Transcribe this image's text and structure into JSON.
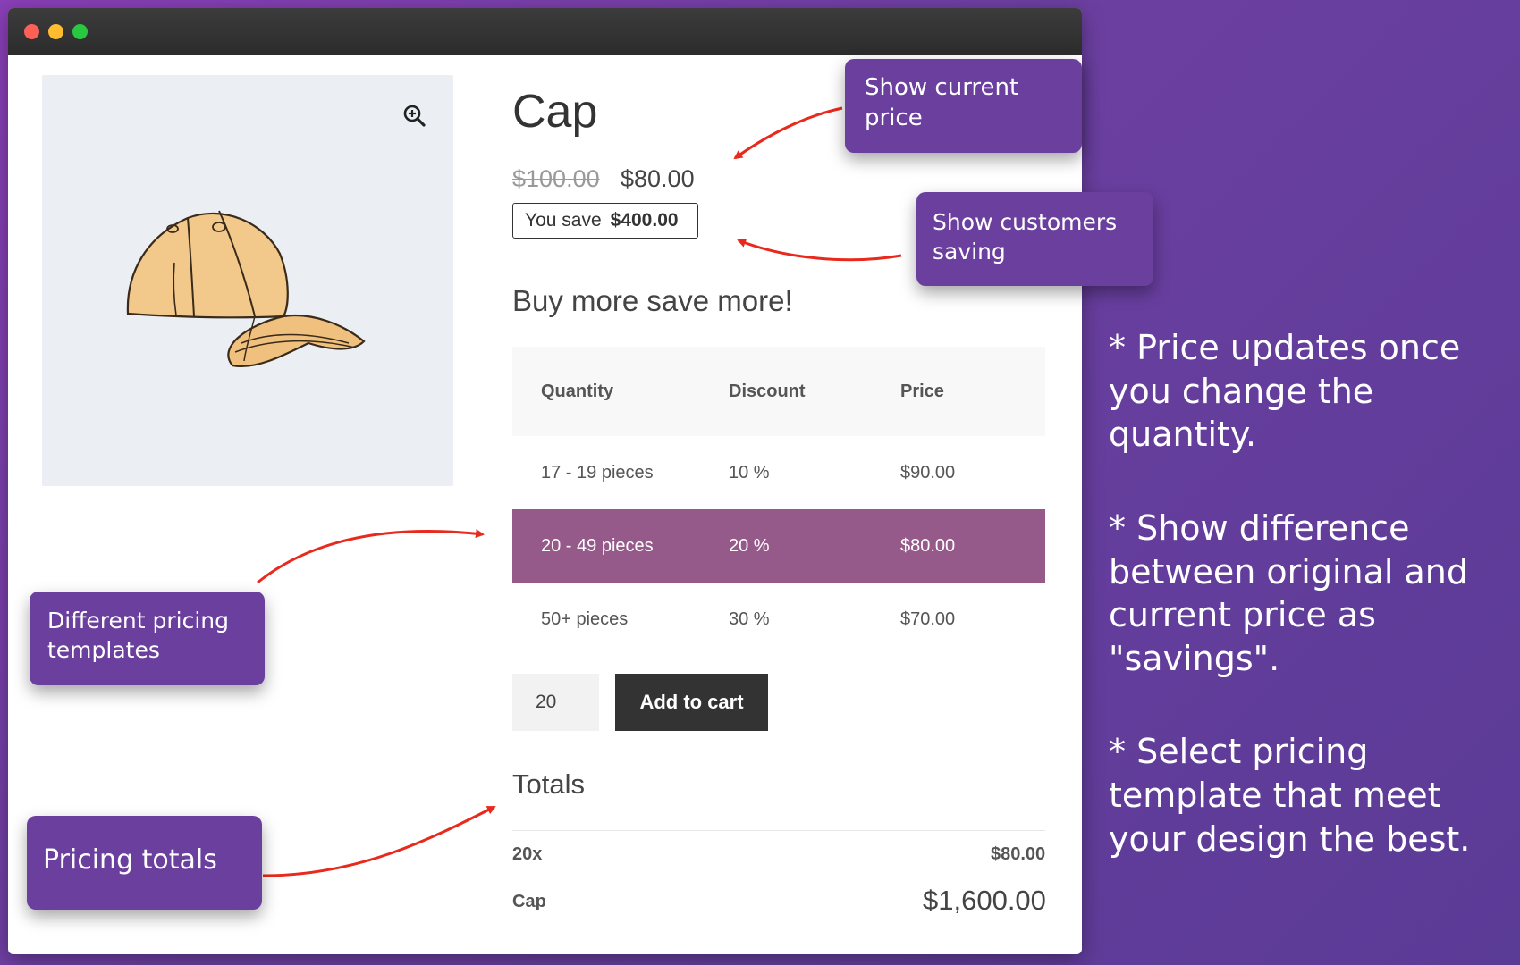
{
  "product": {
    "title": "Cap",
    "price_old": "$100.00",
    "price_new": "$80.00",
    "save_label": "You save",
    "save_amount": "$400.00"
  },
  "pricing": {
    "heading": "Buy more save more!",
    "columns": [
      "Quantity",
      "Discount",
      "Price"
    ],
    "rows": [
      {
        "quantity": "17 - 19 pieces",
        "discount": "10 %",
        "price": "$90.00"
      },
      {
        "quantity": "20 - 49 pieces",
        "discount": "20 %",
        "price": "$80.00"
      },
      {
        "quantity": "50+ pieces",
        "discount": "30 %",
        "price": "$70.00"
      }
    ],
    "active_row_color": "#955a8a"
  },
  "cart": {
    "quantity": "20",
    "add_button": "Add to cart"
  },
  "totals": {
    "heading": "Totals",
    "quantity_label": "20x",
    "unit_price": "$80.00",
    "product_name": "Cap",
    "total": "$1,600.00"
  },
  "callouts": {
    "current_price": "Show current price",
    "customers_saving": "Show customers saving",
    "pricing_templates": "Different pricing templates",
    "pricing_totals": "Pricing totals"
  },
  "notes": [
    "* Price updates once you change the quantity.",
    "* Show difference between original and current price as \"savings\".",
    "* Select pricing template that meet your design the best."
  ],
  "icons": {
    "zoom": "zoom-in-icon",
    "product": "cap-image"
  },
  "colors": {
    "callout": "#6a3f9e",
    "arrow": "#e8291c",
    "button": "#333333"
  }
}
